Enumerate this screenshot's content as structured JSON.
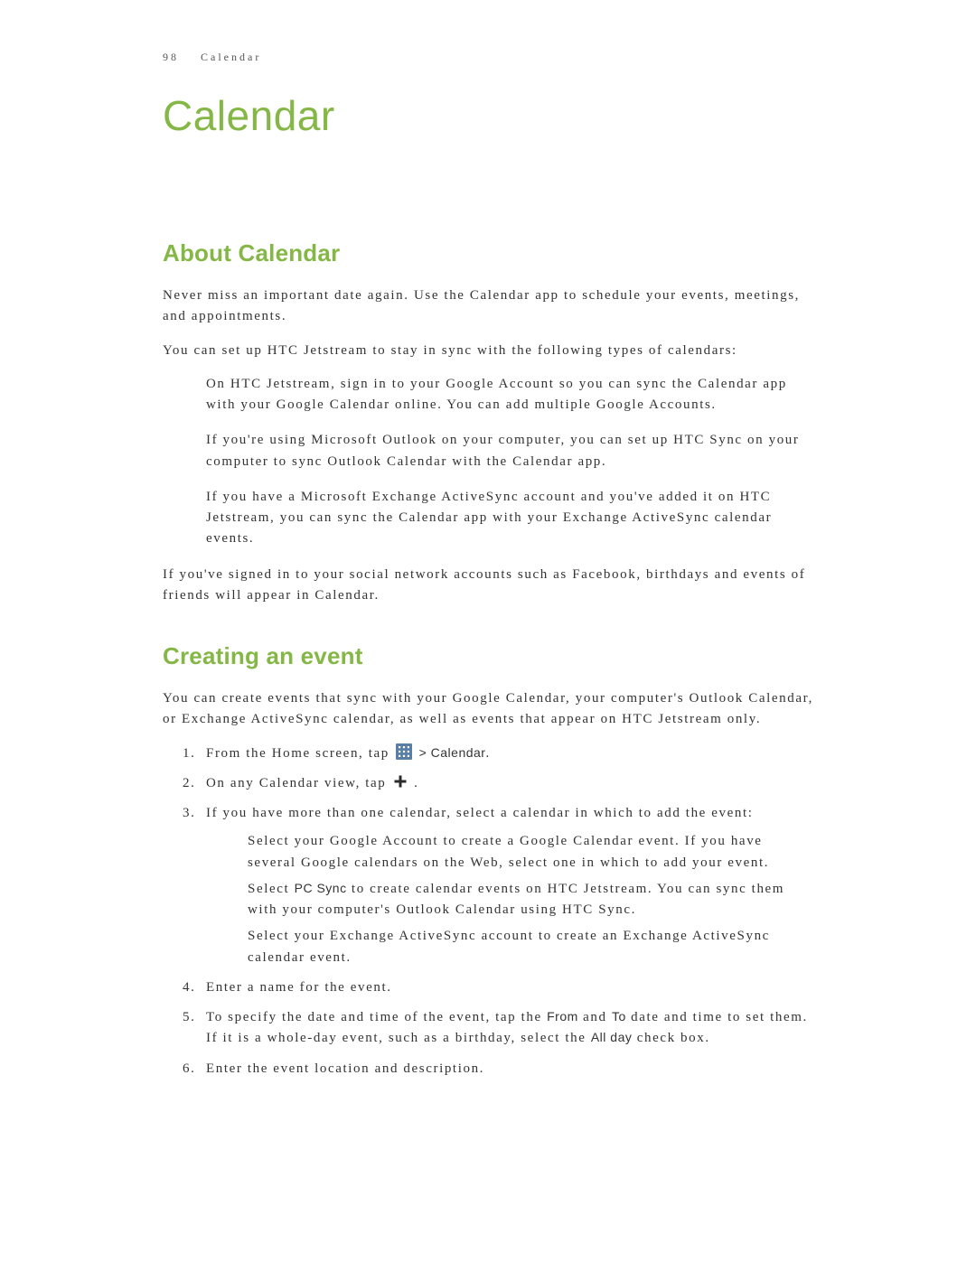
{
  "header": {
    "page_number": "98",
    "section": "Calendar"
  },
  "chapter_title": "Calendar",
  "sections": {
    "about": {
      "title": "About Calendar",
      "p1": "Never miss an important date again. Use the Calendar app to schedule your events, meetings, and appointments.",
      "p2": "You can set up HTC Jetstream to stay in sync with the following types of calendars:",
      "bullets": {
        "b1": "On HTC Jetstream, sign in to your Google Account so you can sync the Calendar app with your Google Calendar online. You can add multiple Google Accounts.",
        "b2": "If you're using Microsoft Outlook on your computer, you can set up HTC Sync on your computer to sync Outlook Calendar with the Calendar app.",
        "b3": "If you have a Microsoft Exchange ActiveSync account and you've added it on HTC Jetstream, you can sync the Calendar app with your Exchange ActiveSync calendar events."
      },
      "p3": "If you've signed in to your social network accounts such as Facebook, birthdays and events of friends will appear in Calendar."
    },
    "creating": {
      "title": "Creating an event",
      "p1": "You can create events that sync with your Google Calendar, your computer's Outlook Calendar, or Exchange ActiveSync calendar, as well as events that appear on HTC Jetstream only.",
      "step1_a": "From the Home screen, tap ",
      "step1_b": " > ",
      "step1_c": "Calendar",
      "step1_d": ".",
      "step2_a": "On any Calendar view, tap ",
      "step2_b": ".",
      "step3": "If you have more than one calendar, select a calendar in which to add the event:",
      "step3_sub": {
        "s1": "Select your Google Account to create a Google Calendar event. If you have several Google calendars on the Web, select one in which to add your event.",
        "s2a": "Select ",
        "s2b": "PC Sync",
        "s2c": " to create calendar events on HTC Jetstream. You can sync them with your computer's Outlook Calendar using HTC Sync.",
        "s3": "Select your Exchange ActiveSync account to create an Exchange ActiveSync calendar event."
      },
      "step4": "Enter a name for the event.",
      "step5_a": "To specify the date and time of the event, tap the ",
      "step5_b": "From",
      "step5_c": " and ",
      "step5_d": "To",
      "step5_e": " date and time to set them. If it is a whole-day event, such as a birthday, select the ",
      "step5_f": "All day",
      "step5_g": " check box.",
      "step6": "Enter the event location and description."
    }
  },
  "icons": {
    "apps_fill": "#5a7fa6",
    "plus_stroke": "#2b2b2b"
  }
}
